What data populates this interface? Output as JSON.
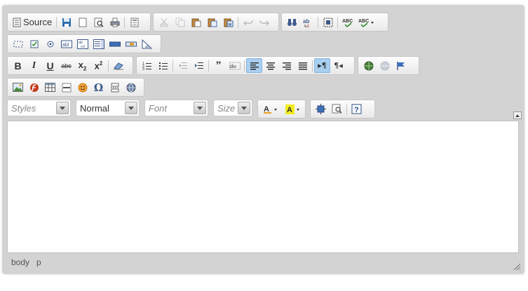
{
  "toolbar": {
    "source_label": "Source",
    "styles_placeholder": "Styles",
    "format_value": "Normal",
    "font_placeholder": "Font",
    "size_placeholder": "Size"
  },
  "path": [
    "body",
    "p"
  ],
  "colors": {
    "active_button": "#a9cff0",
    "toolbar_bg": "#d3d3d3",
    "content_bg": "#ffffff"
  }
}
